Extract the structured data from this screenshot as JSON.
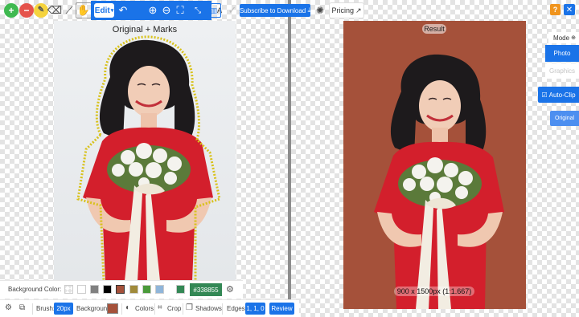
{
  "toolbar": {
    "add_icon": "+",
    "remove_icon": "−",
    "edit_label": "Edit",
    "subscribe_label": "Subscribe to Download",
    "subscribe_icon": "⤓",
    "pricing_label": "Pricing",
    "pricing_icon": "↗"
  },
  "left_panel": {
    "title": "Original + Marks"
  },
  "result_panel": {
    "title": "Result",
    "size_label": "900 x 1500px (1:1.667)"
  },
  "right_controls": {
    "help_label": "?",
    "close_label": "✕",
    "mode_label": "Mode",
    "mode_options": [
      "Photo",
      "Graphics"
    ],
    "selected_mode": "Photo",
    "autoclip_label": "Auto-Clip",
    "autoclip_checked": true,
    "original_label": "Original"
  },
  "background_bar": {
    "label": "Background Color:",
    "swatches": [
      "#ffffff",
      "#808080",
      "#000000",
      "#a5513a",
      "#a08a3a",
      "#4a9a3a",
      "#8fb5d9",
      "#338855"
    ],
    "selected_swatch": "#a5513a",
    "hex_value": "#338855"
  },
  "bottom_bar": {
    "brush_label": "Brush:",
    "brush_size": "20px",
    "background_label": "Background:",
    "background_color": "#a5513a",
    "colors_label": "Colors",
    "crop_label": "Crop",
    "shadows_label": "Shadows",
    "edges_label": "Edges:",
    "edges_value": "1, 1, 0",
    "review_label": "Review"
  },
  "colors": {
    "accent": "#1a73e8",
    "warning": "#f0941d"
  }
}
